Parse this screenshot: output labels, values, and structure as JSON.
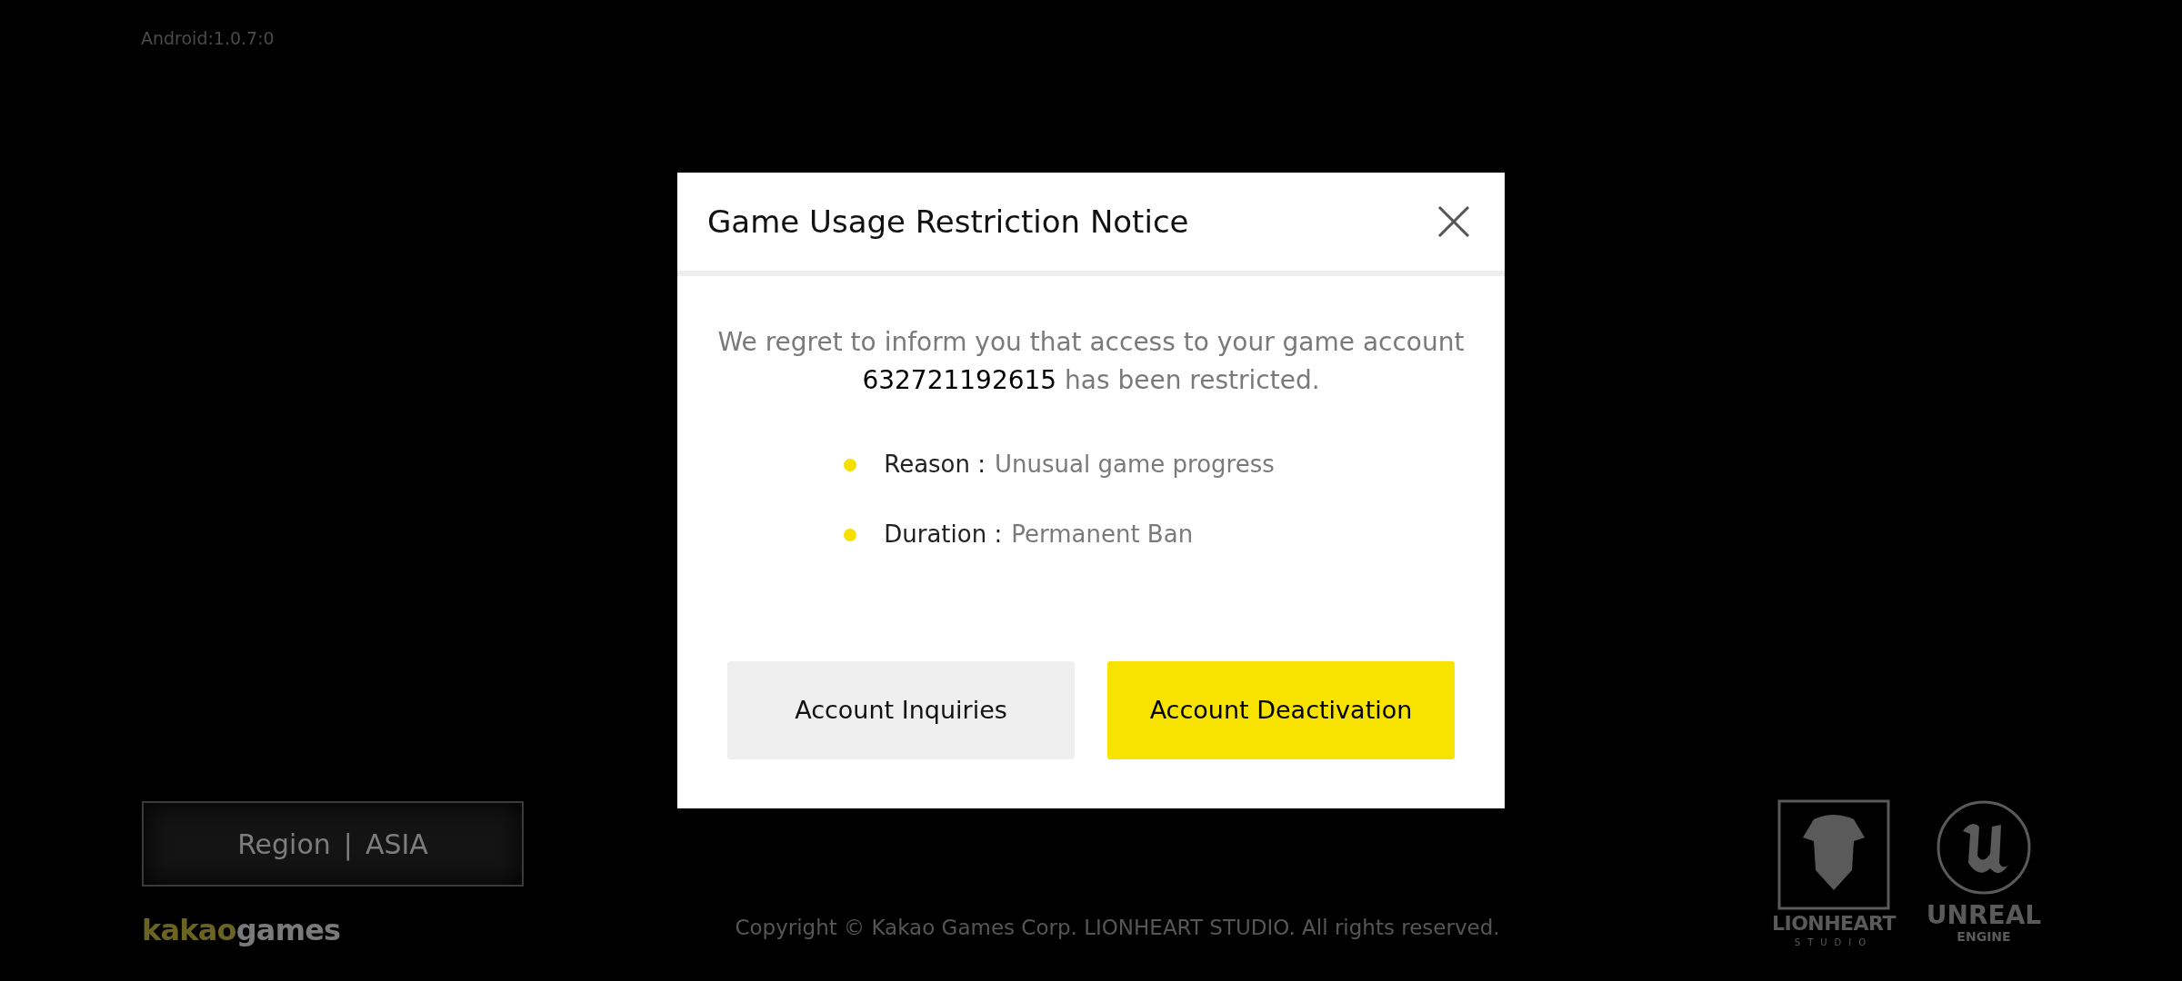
{
  "version": "Android:1.0.7:0",
  "region_button": {
    "label": "Region",
    "separator": "|",
    "value": "ASIA"
  },
  "publisher_logo": {
    "parts": [
      {
        "text": "kakao",
        "color": "#6b6322"
      },
      {
        "text": "games",
        "color": "#7a7a7a"
      }
    ]
  },
  "copyright": "Copyright © Kakao Games Corp. LIONHEART STUDIO. All rights reserved.",
  "studio_logo": {
    "name": "LIONHEART",
    "subtitle": "STUDIO"
  },
  "engine_logo": {
    "name": "UNREAL",
    "subtitle": "ENGINE"
  },
  "dialog": {
    "title": "Game Usage Restriction Notice",
    "message": "We regret to inform you that access to your game account **632721192615** has been restricted.",
    "details": [
      {
        "label": "Reason :",
        "value": "Unusual game progress",
        "color": "#f7e000"
      },
      {
        "label": "Duration :",
        "value": "Permanent Ban",
        "color": "#f7e000"
      }
    ],
    "buttons": [
      {
        "label": "Account Inquiries",
        "kind": "secondary"
      },
      {
        "label": "Account Deactivation",
        "kind": "primary"
      }
    ]
  }
}
